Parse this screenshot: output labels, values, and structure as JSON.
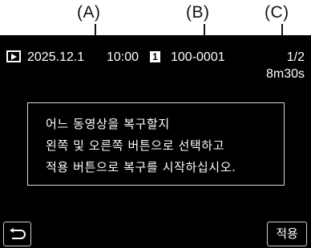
{
  "callouts": {
    "a": "(A)",
    "b": "(B)",
    "c": "(C)"
  },
  "status_bar": {
    "mode_icon": "playback-icon",
    "date": "2025.12.1",
    "time": "10:00",
    "card_slot": "1",
    "folder_file": "100-0001",
    "counter": "1/2",
    "duration": "8m30s"
  },
  "dialog": {
    "line1": "어느 동영상을 복구할지",
    "line2": "왼쪽 및 오른쪽 버튼으로 선택하고",
    "line3": "적용 버튼으로 복구를 시작하십시오."
  },
  "footer": {
    "back_icon": "return-arrow-icon",
    "apply_label": "적용"
  }
}
